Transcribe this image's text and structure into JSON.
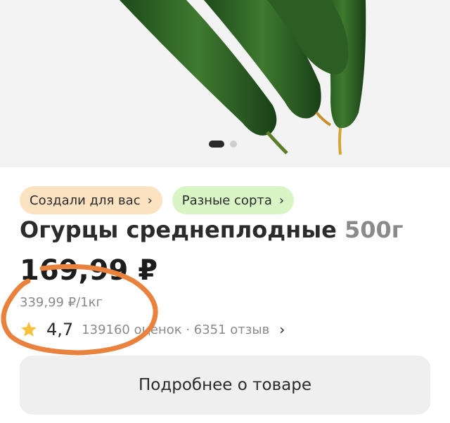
{
  "gallery": {
    "image": "cucumbers-photo",
    "active_index": 1,
    "total": 2
  },
  "tags": [
    {
      "label": "Создали для вас",
      "icon": "chevron-right-icon",
      "color": "#fbe3c2"
    },
    {
      "label": "Разные сорта",
      "icon": "chevron-right-icon",
      "color": "#d9f5c6"
    }
  ],
  "product": {
    "name": "Огурцы среднеплодные",
    "weight": "500г",
    "price": "169,99 ₽",
    "unit_price": "339,99 ₽/1кг"
  },
  "rating": {
    "icon": "star-icon",
    "value": "4,7",
    "meta": "139160 оценок · 6351 отзыв"
  },
  "details_button": {
    "label": "Подробнее о товаре"
  },
  "annotation": {
    "icon": "handdrawn-orange-circle",
    "color": "#e8823c"
  }
}
